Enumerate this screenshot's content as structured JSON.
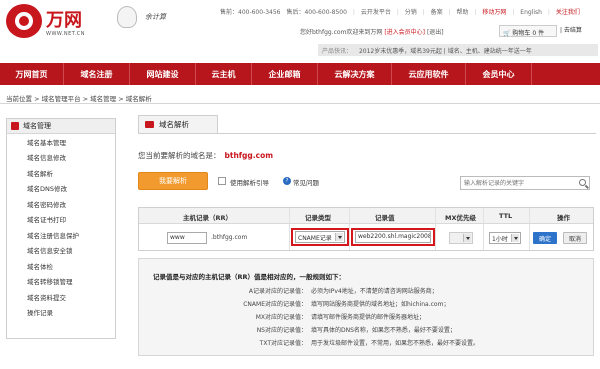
{
  "brand": {
    "name": "万网",
    "url": "WWW.NET.CN",
    "slogan": "余计算"
  },
  "topbar": {
    "presales": "售前：400-600-3456",
    "aftersales": "售后：400-600-8500",
    "links": [
      "云开发平台",
      "分销",
      "备案",
      "帮助",
      "移动万网",
      "English",
      "关注我们"
    ]
  },
  "user": {
    "welcome": "您好bthfgg.com欢迎来到万网",
    "member_center": "[进入会员中心]",
    "logout": "[退出]"
  },
  "cart": {
    "label": "购物车",
    "count": "0",
    "unit": "件",
    "checkout": "| 去结算"
  },
  "promo": {
    "label": "产品快讯：",
    "text1": "2012岁末优惠季，域名39元起",
    "text2": "| 域名、主机、建站统一年送一年"
  },
  "nav": [
    {
      "label": "万网首页"
    },
    {
      "label": "域名注册"
    },
    {
      "label": "网站建设"
    },
    {
      "label": "云主机"
    },
    {
      "label": "企业邮箱"
    },
    {
      "label": "云解决方案"
    },
    {
      "label": "云应用软件"
    },
    {
      "label": "会员中心"
    }
  ],
  "breadcrumb": "当前位置 > 域名管理平台 > 域名管理 > 域名解析",
  "sidebar": {
    "title": "域名管理",
    "items": [
      "域名基本管理",
      "域名信息修改",
      "域名解析",
      "域名DNS修改",
      "域名密码修改",
      "域名证书打印",
      "域名注册信息保护",
      "域名信息安全锁",
      "域名体检",
      "域名转移锁管理",
      "域名资料提交",
      "操作记录"
    ]
  },
  "main": {
    "tab": "域名解析",
    "current_domain_label": "您当前要解析的域名是：",
    "current_domain": "bthfgg.com",
    "add_button": "我要解析",
    "guide_label": "使用解析引导",
    "faq_label": "常见问题",
    "search_placeholder": "输入解析记录的关键字"
  },
  "table": {
    "headers": {
      "host": "主机记录（RR）",
      "type": "记录类型",
      "value": "记录值",
      "mx": "MX优先级",
      "ttl": "TTL",
      "op": "操作"
    },
    "row": {
      "host": "www",
      "domain_suffix": ".bthfgg.com",
      "type": "CNAME记录",
      "value": "web2200.shl.magic2008",
      "mx": "",
      "ttl": "1小时",
      "confirm": "确定",
      "cancel": "取消"
    }
  },
  "info": {
    "title": "记录值是与对应的主机记录（RR）值是相对应的，一般规则如下：",
    "rows": [
      {
        "k": "A记录对应的记录值：",
        "v": "必须为IPv4地址，不清楚的请咨询网站服务商；"
      },
      {
        "k": "CNAME对应的记录值：",
        "v": "填写网站服务商提供的域名地址；如hichina.com；"
      },
      {
        "k": "MX对应的记录值：",
        "v": "请填写邮件服务商提供的邮件服务器地址；"
      },
      {
        "k": "NS对应的记录值：",
        "v": "填写具体的DNS名称，如果您不熟悉，最好不要设置；"
      },
      {
        "k": "TXT对应记录值：",
        "v": "用于发垃圾邮件设置，不常用，如果您不熟悉，最好不要设置。"
      }
    ]
  },
  "colors": {
    "brand_red": "#b7161c",
    "accent_orange": "#f29a2e",
    "button_blue": "#2d73c9"
  }
}
